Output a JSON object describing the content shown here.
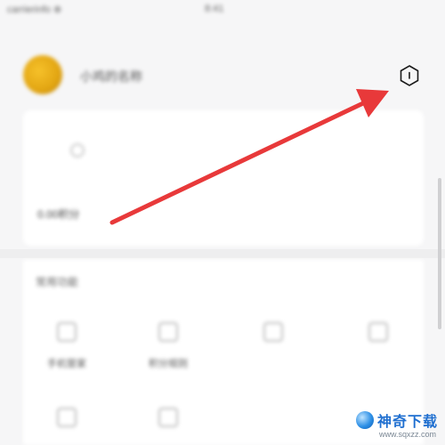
{
  "status_bar": {
    "carrier": "carrierinfo ⊕",
    "clock": "8:41"
  },
  "profile": {
    "username": "小鸡的名称",
    "settings_icon": "hexagon-settings-icon"
  },
  "card": {
    "icon": "info-icon",
    "label": "0.00积分"
  },
  "section": {
    "title": "常用功能",
    "tools": [
      {
        "label": "手机管家",
        "icon": "home-icon"
      },
      {
        "label": "积分规则",
        "icon": "tree-icon"
      },
      {
        "label": "",
        "icon": "message-icon"
      },
      {
        "label": "",
        "icon": "chat-icon"
      },
      {
        "label": "",
        "icon": "tag-icon"
      },
      {
        "label": "",
        "icon": "edit-icon"
      }
    ]
  },
  "annotation": {
    "color": "#e8393a"
  },
  "watermark": {
    "title": "神奇下载",
    "url": "www.sqxzz.com"
  }
}
